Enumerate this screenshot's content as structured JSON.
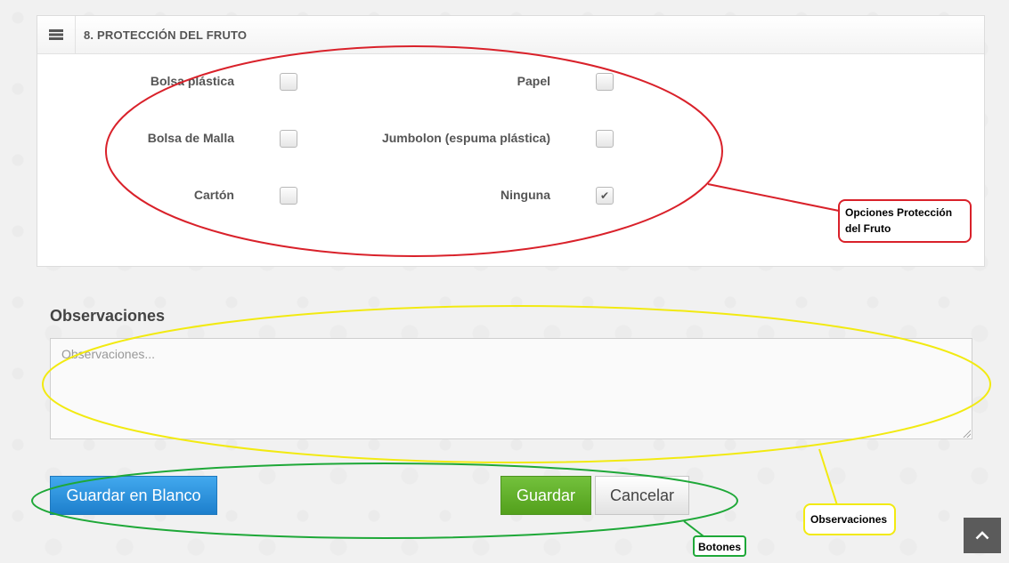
{
  "section": {
    "title": "8. PROTECCIÓN DEL FRUTO",
    "options": [
      {
        "label": "Bolsa plástica",
        "checked": false
      },
      {
        "label": "Papel",
        "checked": false
      },
      {
        "label": "Bolsa de Malla",
        "checked": false
      },
      {
        "label": "Jumbolon (espuma plástica)",
        "checked": false
      },
      {
        "label": "Cartón",
        "checked": false
      },
      {
        "label": "Ninguna",
        "checked": true
      }
    ]
  },
  "observaciones": {
    "label": "Observaciones",
    "placeholder": "Observaciones...",
    "value": ""
  },
  "buttons": {
    "blank_save": "Guardar en Blanco",
    "save": "Guardar",
    "cancel": "Cancelar"
  },
  "annotations": {
    "options_note": "Opciones Protección del Fruto",
    "observations_note": "Observaciones",
    "buttons_note": "Botones"
  },
  "colors": {
    "options_ring": "#d9212a",
    "observations_ring": "#f2ea11",
    "buttons_ring": "#1ea838",
    "primary_blue": "#2a8fdb",
    "save_green": "#62b02b"
  }
}
